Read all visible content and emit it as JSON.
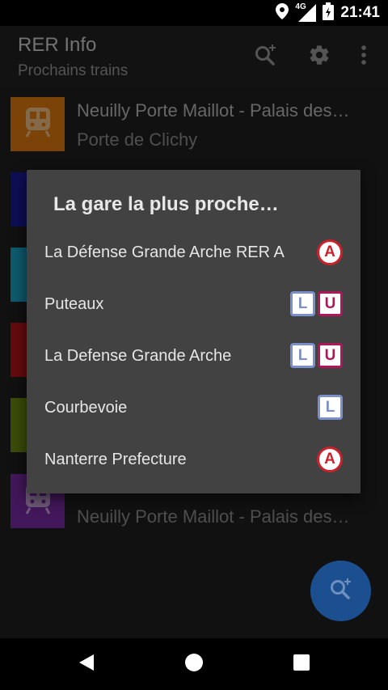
{
  "status_bar": {
    "time": "21:41",
    "network": "4G",
    "icons": [
      "location-icon",
      "signal-icon",
      "battery-icon"
    ]
  },
  "toolbar": {
    "title": "RER Info",
    "subtitle": "Prochains trains",
    "icons": [
      "search-add-icon",
      "settings-icon",
      "more-vert-icon"
    ]
  },
  "list": {
    "rows": [
      {
        "line1": "Neuilly Porte Maillot - Palais des…",
        "line2": "Porte de Clichy",
        "color": "#e07a10"
      },
      {
        "line1": "",
        "line2": "",
        "color": "#1b1a9c"
      },
      {
        "line1": "",
        "line2": "",
        "color": "#1aa5c7"
      },
      {
        "line1": "",
        "line2": "",
        "color": "#b8141a"
      },
      {
        "line1": "",
        "line2": "",
        "color": "#6a8a12"
      },
      {
        "line1": "",
        "line2": "Neuilly Porte Maillot - Palais des…",
        "color": "#7a2aa6"
      }
    ]
  },
  "dialog": {
    "title": "La gare la plus proche…",
    "items": [
      {
        "name": "La Défense Grande Arche RER A",
        "badges": [
          {
            "letter": "A",
            "shape": "circle",
            "color": "#c9222d"
          }
        ]
      },
      {
        "name": "Puteaux",
        "badges": [
          {
            "letter": "L",
            "shape": "square",
            "color": "#7b8fcc"
          },
          {
            "letter": "U",
            "shape": "square",
            "color": "#b1165a"
          }
        ]
      },
      {
        "name": "La Defense Grande Arche",
        "badges": [
          {
            "letter": "L",
            "shape": "square",
            "color": "#7b8fcc"
          },
          {
            "letter": "U",
            "shape": "square",
            "color": "#b1165a"
          }
        ]
      },
      {
        "name": "Courbevoie",
        "badges": [
          {
            "letter": "L",
            "shape": "square",
            "color": "#7b8fcc"
          }
        ]
      },
      {
        "name": "Nanterre Prefecture",
        "badges": [
          {
            "letter": "A",
            "shape": "circle",
            "color": "#c9222d"
          }
        ]
      }
    ]
  },
  "fab": {
    "icon": "search-add-icon",
    "color": "#1b4f8f"
  },
  "nav_bar": {
    "icons": [
      "back-icon",
      "home-icon",
      "recents-icon"
    ]
  }
}
